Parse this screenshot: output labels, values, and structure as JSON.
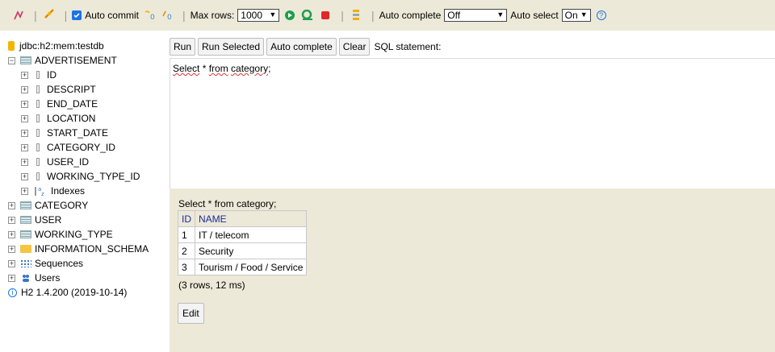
{
  "toolbar": {
    "auto_commit_label": "Auto commit",
    "max_rows_label": "Max rows:",
    "max_rows_value": "1000",
    "auto_complete_label": "Auto complete",
    "auto_complete_value": "Off",
    "auto_select_label": "Auto select",
    "auto_select_value": "On",
    "help_glyph": "?"
  },
  "tree": {
    "connection": "jdbc:h2:mem:testdb",
    "table_advertisement": "ADVERTISEMENT",
    "columns": [
      "ID",
      "DESCRIPT",
      "END_DATE",
      "LOCATION",
      "START_DATE",
      "CATEGORY_ID",
      "USER_ID",
      "WORKING_TYPE_ID"
    ],
    "indexes": "Indexes",
    "table_category": "CATEGORY",
    "table_user": "USER",
    "table_working_type": "WORKING_TYPE",
    "schema": "INFORMATION_SCHEMA",
    "sequences": "Sequences",
    "users": "Users",
    "version": "H2 1.4.200 (2019-10-14)"
  },
  "query_bar": {
    "run": "Run",
    "run_selected": "Run Selected",
    "auto_complete": "Auto complete",
    "clear": "Clear",
    "sql_label": "SQL statement:"
  },
  "editor": {
    "word1": "Select",
    "mid": " * ",
    "word2": "from",
    "sp": " ",
    "word3": "category",
    "end": ";"
  },
  "results": {
    "query": "Select * from category;",
    "headers": [
      "ID",
      "NAME"
    ],
    "rows": [
      [
        "1",
        "IT / telecom"
      ],
      [
        "2",
        "Security"
      ],
      [
        "3",
        "Tourism / Food / Service"
      ]
    ],
    "count": "(3 rows, 12 ms)",
    "edit": "Edit"
  },
  "colors": {
    "toolbar_bg": "#ede9d8",
    "results_bg": "#ede9d8",
    "header_text": "#1a2b9c",
    "accent": "#1a73e8"
  }
}
